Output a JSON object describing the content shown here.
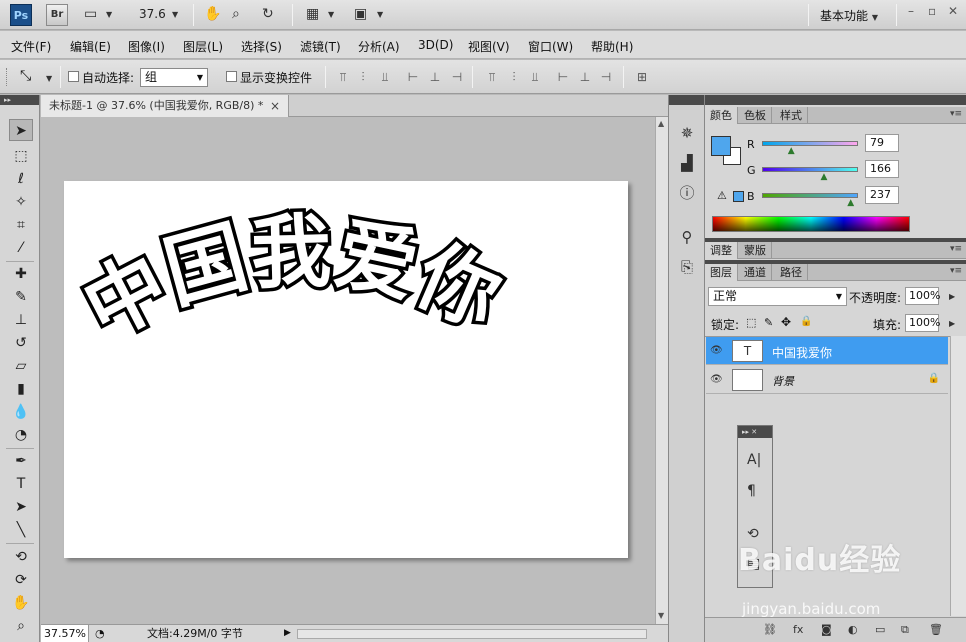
{
  "appbar": {
    "ps_logo": "Ps",
    "br_logo": "Br",
    "zoom": "37.6",
    "workspace": "基本功能"
  },
  "menu": [
    "文件(F)",
    "编辑(E)",
    "图像(I)",
    "图层(L)",
    "选择(S)",
    "滤镜(T)",
    "分析(A)",
    "3D(D)",
    "视图(V)",
    "窗口(W)",
    "帮助(H)"
  ],
  "options": {
    "auto_select_label": "自动选择:",
    "auto_select_value": "组",
    "show_transform_label": "显示变换控件"
  },
  "document": {
    "tab_title": "未标题-1 @ 37.6% (中国我爱你, RGB/8) *",
    "canvas_text": "中国我爱你"
  },
  "status": {
    "zoom": "37.57%",
    "doc_info": "文档:4.29M/0 字节"
  },
  "color_panel": {
    "tabs": [
      "颜色",
      "色板",
      "样式"
    ],
    "r_label": "R",
    "r_value": "79",
    "r": 79,
    "g_label": "G",
    "g_value": "166",
    "g": 166,
    "b_label": "B",
    "b_value": "237",
    "b": 237,
    "foreground": "#4fa6ed"
  },
  "adjust_panel": {
    "tabs": [
      "调整",
      "蒙版"
    ]
  },
  "layers_panel": {
    "tabs": [
      "图层",
      "通道",
      "路径"
    ],
    "blend_mode": "正常",
    "opacity_label": "不透明度:",
    "opacity_value": "100%",
    "lock_label": "锁定:",
    "fill_label": "填充:",
    "fill_value": "100%",
    "layers": [
      {
        "name": "中国我爱你",
        "selected": true
      },
      {
        "name": "背景",
        "selected": false
      }
    ]
  },
  "watermark": {
    "brand": "Baidu经验",
    "url": "jingyan.baidu.com"
  }
}
